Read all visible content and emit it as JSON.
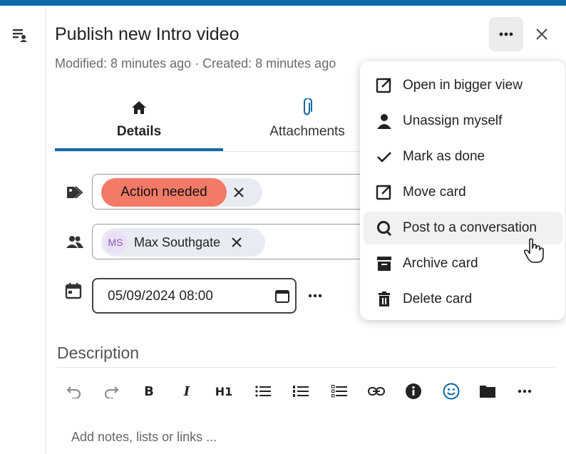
{
  "card": {
    "title": "Publish new Intro video",
    "meta": "Modified: 8 minutes ago · Created: 8 minutes ago"
  },
  "tabs": [
    {
      "label": "Details",
      "icon": "home-icon",
      "active": true
    },
    {
      "label": "Attachments",
      "icon": "paperclip-icon",
      "active": false
    }
  ],
  "tags": [
    {
      "label": "Action needed",
      "color": "#f47a68"
    }
  ],
  "assignees": [
    {
      "initials": "MS",
      "name": "Max Southgate"
    }
  ],
  "due_date": {
    "value": "05/09/2024 08:00"
  },
  "description": {
    "heading": "Description",
    "placeholder": "Add notes, lists or links ...",
    "toolbar": [
      "undo-icon",
      "redo-icon",
      "B",
      "I",
      "H1",
      "bullet-list-icon",
      "numbered-list-icon",
      "checklist-icon",
      "link-icon",
      "info-icon",
      "emoji-icon",
      "folder-icon",
      "more-icon"
    ]
  },
  "menu": {
    "items": [
      {
        "label": "Open in bigger view",
        "icon": "external-link-icon"
      },
      {
        "label": "Unassign myself",
        "icon": "person-icon"
      },
      {
        "label": "Mark as done",
        "icon": "check-icon"
      },
      {
        "label": "Move card",
        "icon": "external-link-icon"
      },
      {
        "label": "Post to a conversation",
        "icon": "talk-icon",
        "hovered": true
      },
      {
        "label": "Archive card",
        "icon": "archive-icon"
      },
      {
        "label": "Delete card",
        "icon": "trash-icon"
      }
    ]
  },
  "colors": {
    "accent": "#0d69a5",
    "tag": "#f47a68"
  }
}
